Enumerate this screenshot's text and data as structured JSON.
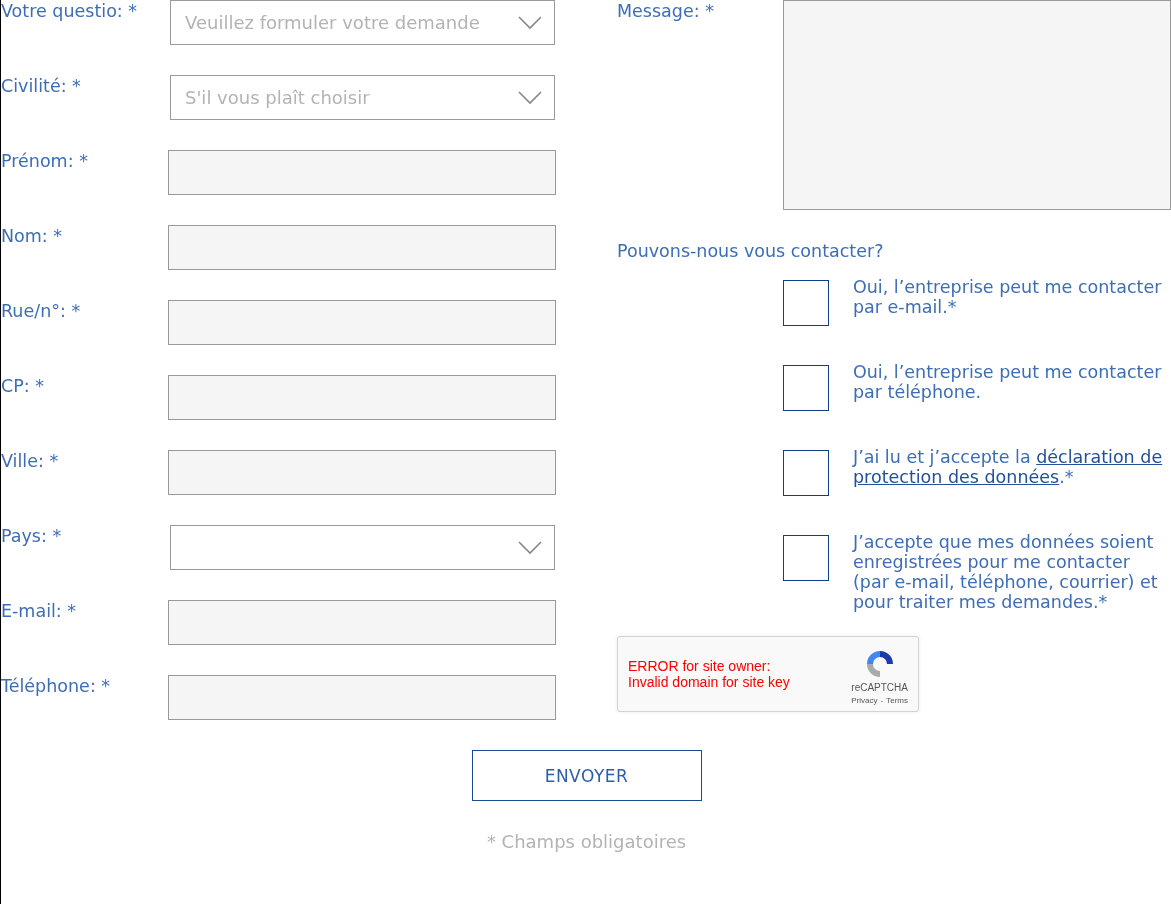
{
  "fields": [
    {
      "label": "Votre questio: *",
      "kind": "select",
      "placeholder": "Veuillez formuler votre demande"
    },
    {
      "label": "Civilité: *",
      "kind": "select",
      "placeholder": "S'il vous plaît choisir"
    },
    {
      "label": "Prénom: *",
      "kind": "text"
    },
    {
      "label": "Nom: *",
      "kind": "text"
    },
    {
      "label": "Rue/n°: *",
      "kind": "text"
    },
    {
      "label": "CP: *",
      "kind": "text"
    },
    {
      "label": "Ville: *",
      "kind": "text"
    },
    {
      "label": "Pays: *",
      "kind": "select"
    },
    {
      "label": "E-mail: *",
      "kind": "text"
    },
    {
      "label": "Téléphone: *",
      "kind": "text"
    }
  ],
  "message": {
    "label": "Message: *"
  },
  "contact": {
    "question": "Pouvons-nous vous contacter?",
    "options": [
      {
        "checked": false,
        "text": "Oui, l’entreprise peut me contacter par e-mail.*"
      },
      {
        "checked": false,
        "text": "Oui, l’entreprise peut me contacter par téléphone."
      },
      {
        "checked": false,
        "text": "J’ai lu et j’accepte la ",
        "link_lines": [
          "déclaration de",
          "protection des données"
        ],
        "text_after": ".*"
      },
      {
        "checked": false,
        "text": "J’accepte que mes données soient enregistrées pour me contacter (par e-mail, téléphone, courrier) et pour traiter mes demandes.*"
      }
    ]
  },
  "captcha": {
    "error_lines": [
      "ERROR for site owner:",
      "Invalid domain for site key"
    ],
    "brand": "reCAPTCHA",
    "links": [
      "Privacy",
      "Terms"
    ],
    "separator": "-"
  },
  "submit": "ENVOYER",
  "footnote": "* Champs obligatoires"
}
